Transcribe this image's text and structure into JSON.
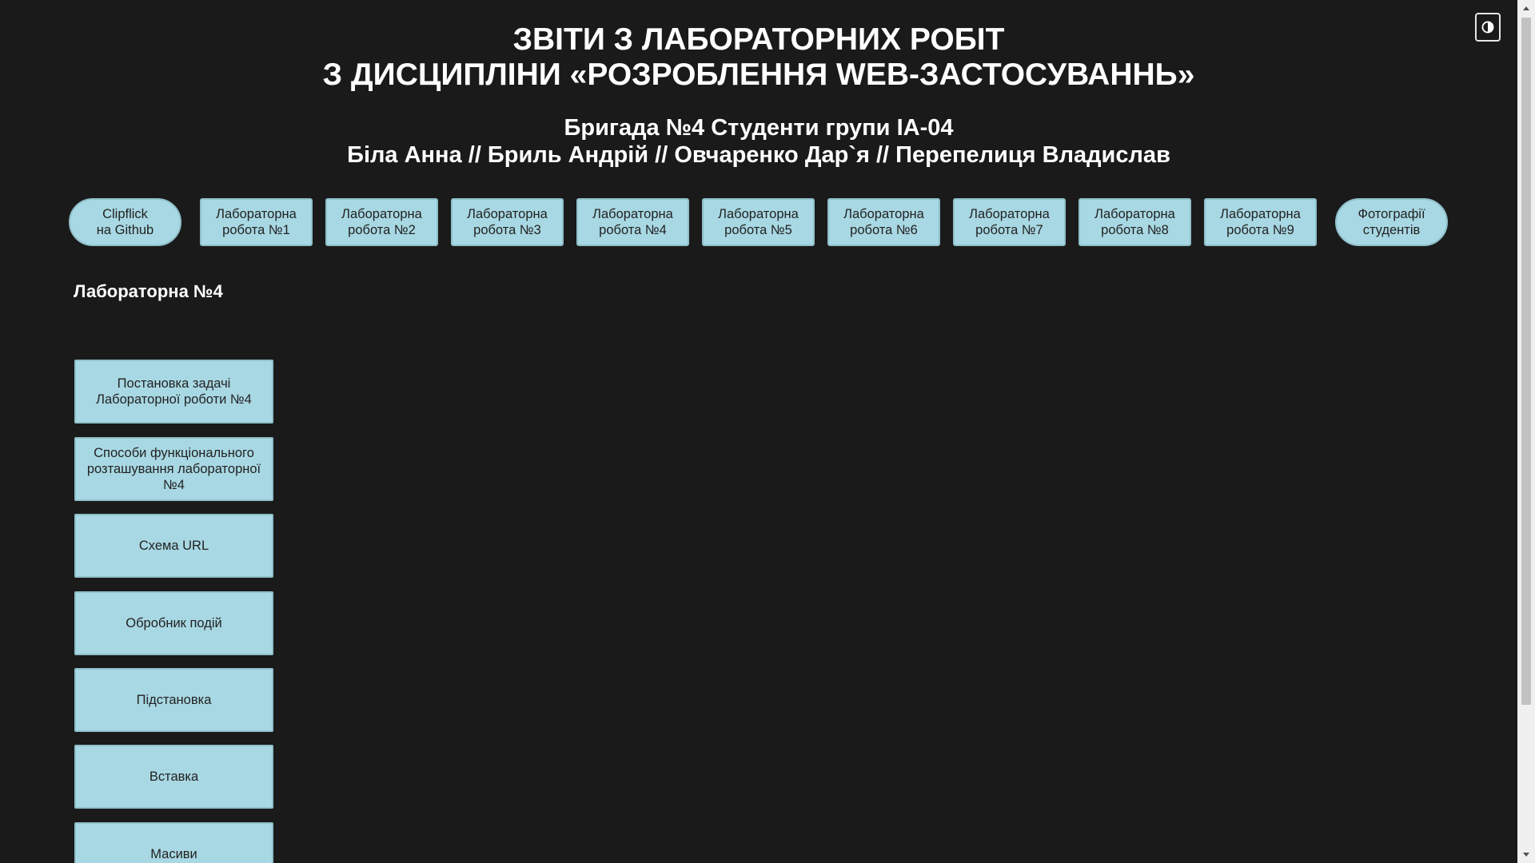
{
  "header": {
    "title_line1": "ЗВІТИ З ЛАБОРАТОРНИХ РОБІТ",
    "title_line2": "З ДИСЦИПЛІНИ «РОЗРОБЛЕННЯ WEB-ЗАСТОСУВАННЬ»",
    "subtitle_line1": "Бригада №4 Студенти групи ІА-04",
    "subtitle_line2": "Біла Анна // Бриль Андрій // Овчаренко Дар`я // Перепелиця Владислав"
  },
  "theme_toggle": {
    "icon": "contrast-icon"
  },
  "nav": {
    "items": [
      {
        "line1": "Clipflick",
        "line2": "на Github"
      },
      {
        "line1": "Лабораторна",
        "line2": "робота №1"
      },
      {
        "line1": "Лабораторна",
        "line2": "робота №2"
      },
      {
        "line1": "Лабораторна",
        "line2": "робота №3"
      },
      {
        "line1": "Лабораторна",
        "line2": "робота №4"
      },
      {
        "line1": "Лабораторна",
        "line2": "робота №5"
      },
      {
        "line1": "Лабораторна",
        "line2": "робота №6"
      },
      {
        "line1": "Лабораторна",
        "line2": "робота №7"
      },
      {
        "line1": "Лабораторна",
        "line2": "робота №8"
      },
      {
        "line1": "Лабораторна",
        "line2": "робота №9"
      },
      {
        "line1": "Фотографії",
        "line2": "студентів"
      }
    ]
  },
  "main": {
    "section_title": "Лабораторна №4",
    "side_items": [
      {
        "label": "Постановка задачі Лабораторної роботи №4"
      },
      {
        "label": "Способи функціонального розташування лабораторної №4"
      },
      {
        "label": "Схема URL"
      },
      {
        "label": "Обробник подій"
      },
      {
        "label": "Підстановка"
      },
      {
        "label": "Вставка"
      },
      {
        "label": "Масиви"
      }
    ]
  },
  "colors": {
    "background": "#1a1a1a",
    "button_bg": "#a8d8e3",
    "button_text": "#222222",
    "heading_text": "#ffffff"
  }
}
